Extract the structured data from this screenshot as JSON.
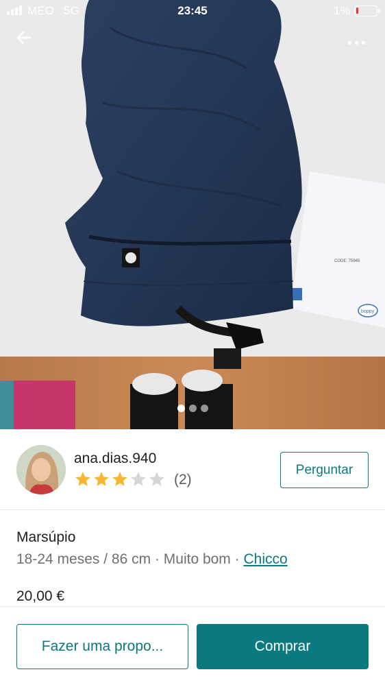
{
  "status_bar": {
    "carrier": "MEO",
    "network": "5G",
    "time": "23:45",
    "battery_percent": "1%",
    "battery_level": 0.01
  },
  "nav": {
    "back_icon": "arrow-left-icon",
    "more_icon": "more-horizontal-icon"
  },
  "gallery": {
    "image_count": 3,
    "active_index": 0,
    "manual_text": "CODE: 75945",
    "manual_brand": "boppy"
  },
  "seller": {
    "username": "ana.dias.940",
    "rating": 3,
    "rating_max": 5,
    "rating_count": "(2)",
    "ask_button": "Perguntar"
  },
  "item": {
    "title": "Marsúpio",
    "size": "18-24 meses / 86 cm",
    "separator": " · ",
    "condition": "Muito bom",
    "brand": "Chicco",
    "price": "20,00 €"
  },
  "actions": {
    "offer_button": "Fazer uma propo...",
    "buy_button": "Comprar"
  },
  "colors": {
    "accent": "#0a7a80",
    "star_filled": "#f5b731",
    "star_empty": "#d6d6d6"
  }
}
